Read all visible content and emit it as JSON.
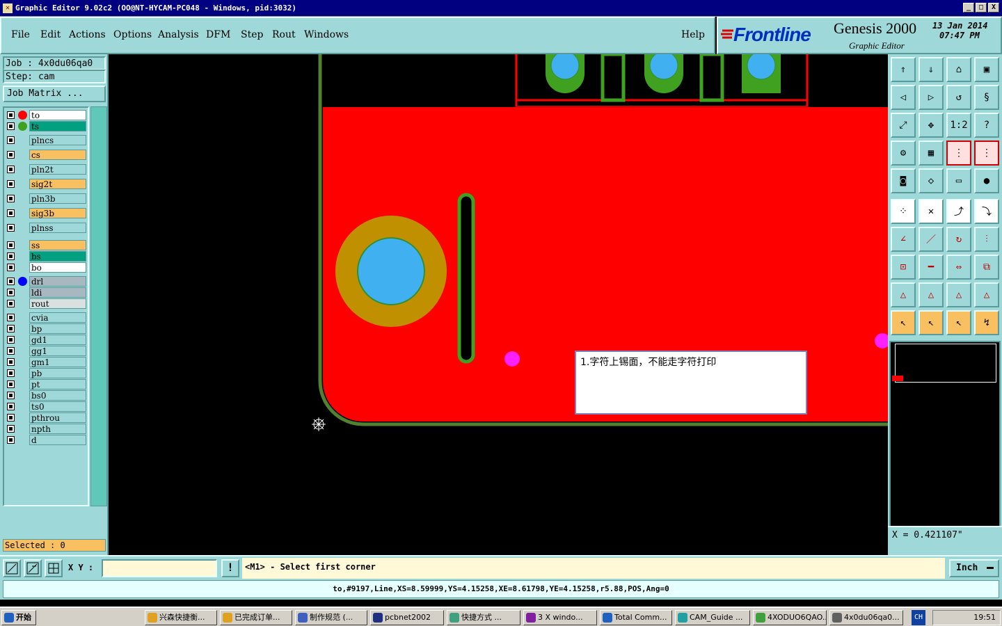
{
  "window": {
    "title": "Graphic Editor 9.02c2 (OO@NT-HYCAM-PC048 - Windows, pid:3032)",
    "min_btn": "_",
    "max_btn": "□",
    "close_btn": "X"
  },
  "menu": {
    "file": "File",
    "edit": "Edit",
    "actions": "Actions",
    "options": "Options",
    "analysis": "Analysis",
    "dfm": "DFM",
    "step": "Step",
    "rout": "Rout",
    "windows": "Windows",
    "help": "Help"
  },
  "brand": {
    "logo": "Frontline",
    "product": "Genesis 2000",
    "subtitle": "Graphic Editor",
    "date": "13 Jan 2014",
    "time": "07:47 PM"
  },
  "job": {
    "job_label": "Job  : 4x0du06qa0",
    "step_label": "Step: cam",
    "matrix_button": "Job Matrix ..."
  },
  "layers": [
    {
      "name": "to",
      "fill": "#ffffff",
      "dot": "#ff0000"
    },
    {
      "name": "ts",
      "fill": "#00a080",
      "dot": "#40a020"
    },
    {
      "name": "plncs",
      "fill": "#9ed8d8",
      "dot": ""
    },
    {
      "name": "cs",
      "fill": "#f8c060",
      "dot": ""
    },
    {
      "name": "pln2t",
      "fill": "#9ed8d8",
      "dot": ""
    },
    {
      "name": "sig2t",
      "fill": "#f8c060",
      "dot": ""
    },
    {
      "name": "pln3b",
      "fill": "#9ed8d8",
      "dot": ""
    },
    {
      "name": "sig3b",
      "fill": "#f8c060",
      "dot": ""
    },
    {
      "name": "plnss",
      "fill": "#9ed8d8",
      "dot": ""
    },
    {
      "name": "ss",
      "fill": "#f8c060",
      "dot": ""
    },
    {
      "name": "bs",
      "fill": "#00a080",
      "dot": ""
    },
    {
      "name": "bo",
      "fill": "#ffffff",
      "dot": ""
    },
    {
      "name": "drl",
      "fill": "#a8b8c0",
      "dot": "#0000ff"
    },
    {
      "name": "ldi",
      "fill": "#a8b8c0",
      "dot": ""
    },
    {
      "name": "rout",
      "fill": "#d8e0e0",
      "dot": ""
    },
    {
      "name": "cvia",
      "fill": "#9ed8d8",
      "dot": ""
    },
    {
      "name": "bp",
      "fill": "#9ed8d8",
      "dot": ""
    },
    {
      "name": "gd1",
      "fill": "#9ed8d8",
      "dot": ""
    },
    {
      "name": "gg1",
      "fill": "#9ed8d8",
      "dot": ""
    },
    {
      "name": "gm1",
      "fill": "#9ed8d8",
      "dot": ""
    },
    {
      "name": "pb",
      "fill": "#9ed8d8",
      "dot": ""
    },
    {
      "name": "pt",
      "fill": "#9ed8d8",
      "dot": ""
    },
    {
      "name": "bs0",
      "fill": "#9ed8d8",
      "dot": ""
    },
    {
      "name": "ts0",
      "fill": "#9ed8d8",
      "dot": ""
    },
    {
      "name": "pthrou",
      "fill": "#9ed8d8",
      "dot": ""
    },
    {
      "name": "npth",
      "fill": "#9ed8d8",
      "dot": ""
    },
    {
      "name": "d",
      "fill": "#9ed8d8",
      "dot": ""
    }
  ],
  "selected": "Selected : 0",
  "note": "1.字符上锡面，不能走字符打印",
  "xy_label": "X Y :",
  "xy_value": "",
  "prompt": "<M1> - Select first corner",
  "units": "Inch",
  "x_readout": "X = 0.421107\"",
  "status": "to,#9197,Line,XS=8.59999,YS=4.15258,XE=8.61798,YE=4.15258,r5.88,POS,Ang=0",
  "taskbar": {
    "start": "开始",
    "tasks": [
      "兴森快捷衡...",
      "已完成订单...",
      "制作规范 (...",
      "pcbnet2002",
      "快捷方式 ...",
      "3 X windo...",
      "Total Comm...",
      "CAM_Guide ...",
      "4XODUO6QAO...",
      "4x0du06qa0..."
    ],
    "ime": "CH",
    "clock": "19:51"
  },
  "tool_icons": [
    "open-icon",
    "save-icon",
    "home-icon",
    "window-icon",
    "prev-icon",
    "next-icon",
    "redraw-icon",
    "snap-icon",
    "zoom-fit-icon",
    "zoom-center-icon",
    "scale-icon",
    "help-icon",
    "measure-icon",
    "grid-icon",
    "layers-red-icon",
    "layers-red2-icon",
    "display-icon",
    "edit-shape-icon",
    "ruler-icon",
    "pad-icon",
    "connect-icon",
    "delete-icon",
    "move-icon",
    "copy-icon",
    "angle-icon",
    "line-icon",
    "arc-icon",
    "flip-icon",
    "pair-icon",
    "split-icon",
    "stretch-icon",
    "group-icon",
    "tri1-icon",
    "tri2-icon",
    "tri3-icon",
    "tri4-icon",
    "select-icon",
    "select-box-icon",
    "select-zone-icon",
    "select-net-icon"
  ]
}
